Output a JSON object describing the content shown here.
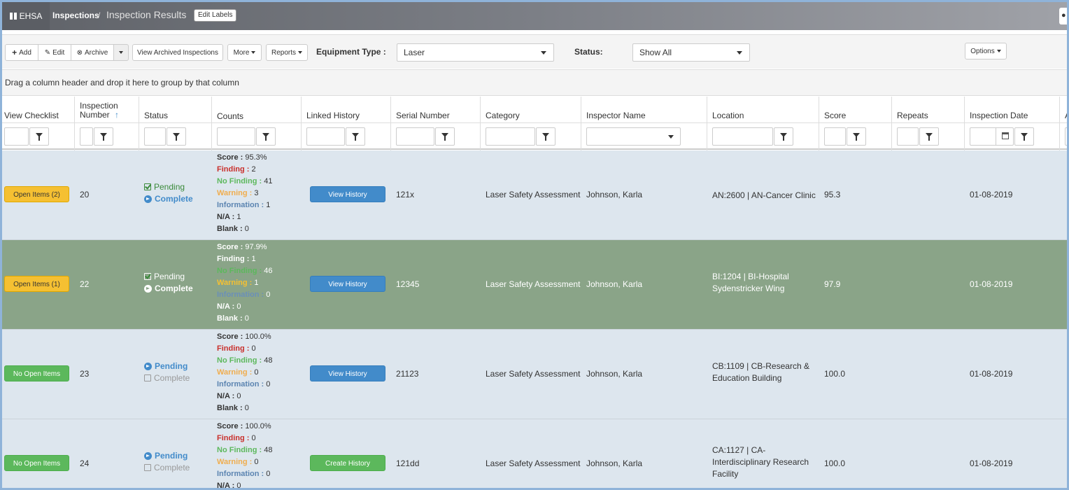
{
  "topbar": {
    "brand": "EHSA",
    "crumb_parent": "Inspections",
    "crumb_sep": "/",
    "crumb_current": "Inspection Results",
    "edit_labels": "Edit Labels"
  },
  "toolbar": {
    "add": "Add",
    "edit": "Edit",
    "archive": "Archive",
    "view_archived": "View Archived Inspections",
    "more": "More",
    "reports": "Reports",
    "equipment_label": "Equipment Type :",
    "equipment_value": "Laser",
    "status_label": "Status:",
    "status_value": "Show All",
    "options": "Options"
  },
  "groupbar": "Drag a column header and drop it here to group by that column",
  "columns": {
    "view_checklist": "View Checklist",
    "inspection_number_1": "Inspection",
    "inspection_number_2": "Number",
    "sort_arrow": "↑",
    "status": "Status",
    "counts": "Counts",
    "linked_history": "Linked History",
    "serial_number": "Serial Number",
    "category": "Category",
    "inspector_name": "Inspector Name",
    "location": "Location",
    "score": "Score",
    "repeats": "Repeats",
    "inspection_date": "Inspection Date",
    "overflow": "A"
  },
  "labels": {
    "score": "Score :",
    "finding": "Finding :",
    "no_finding": "No Finding :",
    "warning": "Warning :",
    "information": "Information :",
    "na": "N/A :",
    "blank": "Blank :",
    "pending": "Pending",
    "complete": "Complete"
  },
  "rows": [
    {
      "checklist": "Open Items (2)",
      "number": "20",
      "score_pct": "95.3%",
      "finding": "2",
      "no_finding": "41",
      "warning": "3",
      "information": "1",
      "na": "1",
      "blank": "0",
      "history_button": "View History",
      "serial": "121x",
      "category": "Laser Safety Assessment",
      "inspector": "Johnson, Karla",
      "location_1": "AN:2600 | AN-Cancer Clinic",
      "location_2": "",
      "location_3": "",
      "score": "95.3",
      "date": "01-08-2019"
    },
    {
      "checklist": "Open Items (1)",
      "number": "22",
      "score_pct": "97.9%",
      "finding": "1",
      "no_finding": "46",
      "warning": "1",
      "information": "0",
      "na": "0",
      "blank": "0",
      "history_button": "View History",
      "serial": "12345",
      "category": "Laser Safety Assessment",
      "inspector": "Johnson, Karla",
      "location_1": "BI:1204 | BI-Hospital",
      "location_2": "Sydenstricker Wing",
      "location_3": "",
      "score": "97.9",
      "date": "01-08-2019"
    },
    {
      "checklist": "No Open Items",
      "number": "23",
      "score_pct": "100.0%",
      "finding": "0",
      "no_finding": "48",
      "warning": "0",
      "information": "0",
      "na": "0",
      "blank": "0",
      "history_button": "View History",
      "serial": "21123",
      "category": "Laser Safety Assessment",
      "inspector": "Johnson, Karla",
      "location_1": "CB:1109 | CB-Research &",
      "location_2": "Education Building",
      "location_3": "",
      "score": "100.0",
      "date": "01-08-2019"
    },
    {
      "checklist": "No Open Items",
      "number": "24",
      "score_pct": "100.0%",
      "finding": "0",
      "no_finding": "48",
      "warning": "0",
      "information": "0",
      "na": "0",
      "blank": "",
      "history_button": "Create History",
      "serial": "121dd",
      "category": "Laser Safety Assessment",
      "inspector": "Johnson, Karla",
      "location_1": "CA:1127 | CA-",
      "location_2": "Interdisciplinary Research",
      "location_3": "Facility",
      "score": "100.0",
      "date": "01-08-2019"
    }
  ]
}
